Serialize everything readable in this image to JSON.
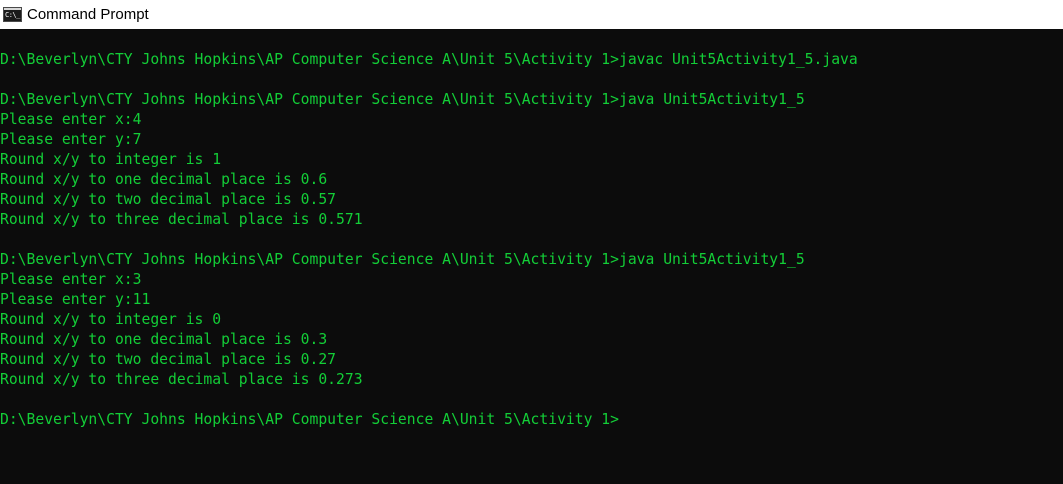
{
  "window": {
    "title": "Command Prompt",
    "icon_text": "C:\\_",
    "text_color": "#13ce37",
    "background_color": "#0c0c0c"
  },
  "console": {
    "lines": [
      "D:\\Beverlyn\\CTY Johns Hopkins\\AP Computer Science A\\Unit 5\\Activity 1>javac Unit5Activity1_5.java",
      "",
      "D:\\Beverlyn\\CTY Johns Hopkins\\AP Computer Science A\\Unit 5\\Activity 1>java Unit5Activity1_5",
      "Please enter x:4",
      "Please enter y:7",
      "Round x/y to integer is 1",
      "Round x/y to one decimal place is 0.6",
      "Round x/y to two decimal place is 0.57",
      "Round x/y to three decimal place is 0.571",
      "",
      "D:\\Beverlyn\\CTY Johns Hopkins\\AP Computer Science A\\Unit 5\\Activity 1>java Unit5Activity1_5",
      "Please enter x:3",
      "Please enter y:11",
      "Round x/y to integer is 0",
      "Round x/y to one decimal place is 0.3",
      "Round x/y to two decimal place is 0.27",
      "Round x/y to three decimal place is 0.273",
      "",
      "D:\\Beverlyn\\CTY Johns Hopkins\\AP Computer Science A\\Unit 5\\Activity 1>"
    ]
  }
}
